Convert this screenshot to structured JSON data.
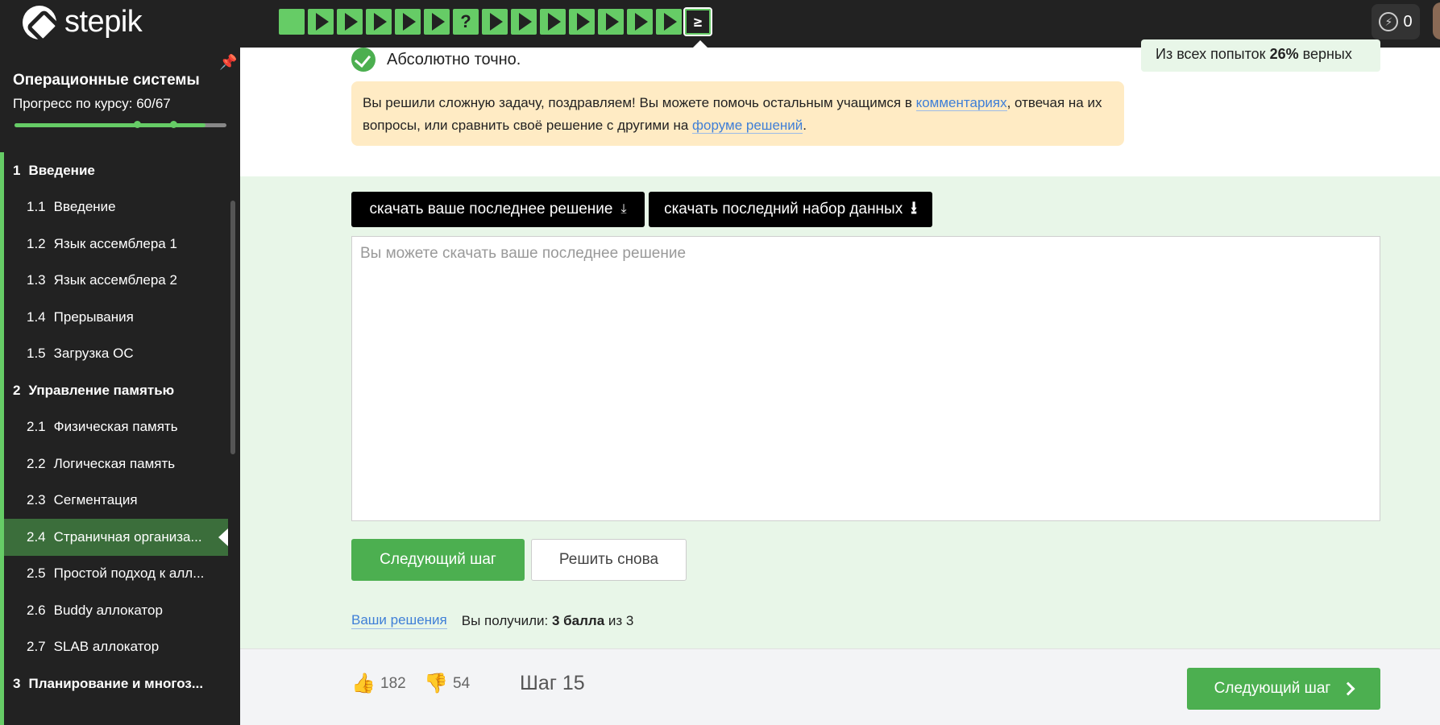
{
  "brand": {
    "name": "stepik"
  },
  "header": {
    "steps": [
      {
        "type": "square"
      },
      {
        "type": "play"
      },
      {
        "type": "play"
      },
      {
        "type": "play"
      },
      {
        "type": "play"
      },
      {
        "type": "play"
      },
      {
        "type": "quiz",
        "label": "?"
      },
      {
        "type": "play"
      },
      {
        "type": "play"
      },
      {
        "type": "play"
      },
      {
        "type": "play"
      },
      {
        "type": "play"
      },
      {
        "type": "play"
      },
      {
        "type": "play"
      },
      {
        "type": "code"
      }
    ],
    "energy_count": "0",
    "colors": {
      "background": "#222222",
      "step_done": "#66cc66"
    }
  },
  "sidebar": {
    "course_title": "Операционные системы",
    "progress_label": "Прогресс по курсу:",
    "progress_value": "60/67",
    "progress_fraction": 0.9,
    "items": [
      {
        "num": "1",
        "label": "Введение",
        "kind": "section"
      },
      {
        "num": "1.1",
        "label": "Введение",
        "kind": "lesson"
      },
      {
        "num": "1.2",
        "label": "Язык ассемблера 1",
        "kind": "lesson"
      },
      {
        "num": "1.3",
        "label": "Язык ассемблера 2",
        "kind": "lesson"
      },
      {
        "num": "1.4",
        "label": "Прерывания",
        "kind": "lesson"
      },
      {
        "num": "1.5",
        "label": "Загрузка ОС",
        "kind": "lesson"
      },
      {
        "num": "2",
        "label": "Управление памятью",
        "kind": "section"
      },
      {
        "num": "2.1",
        "label": "Физическая память",
        "kind": "lesson"
      },
      {
        "num": "2.2",
        "label": "Логическая память",
        "kind": "lesson"
      },
      {
        "num": "2.3",
        "label": "Сегментация",
        "kind": "lesson"
      },
      {
        "num": "2.4",
        "label": "Страничная организа...",
        "kind": "lesson",
        "active": true
      },
      {
        "num": "2.5",
        "label": "Простой подход к алл...",
        "kind": "lesson"
      },
      {
        "num": "2.6",
        "label": "Buddy аллокатор",
        "kind": "lesson"
      },
      {
        "num": "2.7",
        "label": "SLAB аллокатор",
        "kind": "lesson"
      },
      {
        "num": "3",
        "label": "Планирование и многоз...",
        "kind": "section"
      }
    ]
  },
  "main": {
    "stats": {
      "prefix": "Из всех попыток",
      "percent": "26%",
      "suffix": "верных"
    },
    "result_text": "Абсолютно точно.",
    "notice": {
      "part1": "Вы решили сложную задачу, поздравляем! Вы можете помочь остальным учащимся в ",
      "link1": "комментариях",
      "part2": ", отвечая на их вопросы, или сравнить своё решение с другими на ",
      "link2": "форуме решений",
      "part3": "."
    },
    "download_solution_label": "скачать ваше последнее решение",
    "download_dataset_label": "скачать последний набор данных",
    "answer_placeholder": "Вы можете скачать ваше последнее решение",
    "next_step_label": "Следующий шаг",
    "solve_again_label": "Решить снова",
    "your_solutions_link": "Ваши решения",
    "score_prefix": "Вы получили:",
    "score_value": "3 балла",
    "score_suffix": "из 3",
    "colors": {
      "accent": "#4caf50",
      "link": "#3f7fd7",
      "notice_bg": "#ffebc4",
      "zone_bg": "#e8f6e8"
    }
  },
  "footer": {
    "likes": "182",
    "dislikes": "54",
    "step_label": "Шаг 15",
    "next_step_label": "Следующий шаг"
  }
}
